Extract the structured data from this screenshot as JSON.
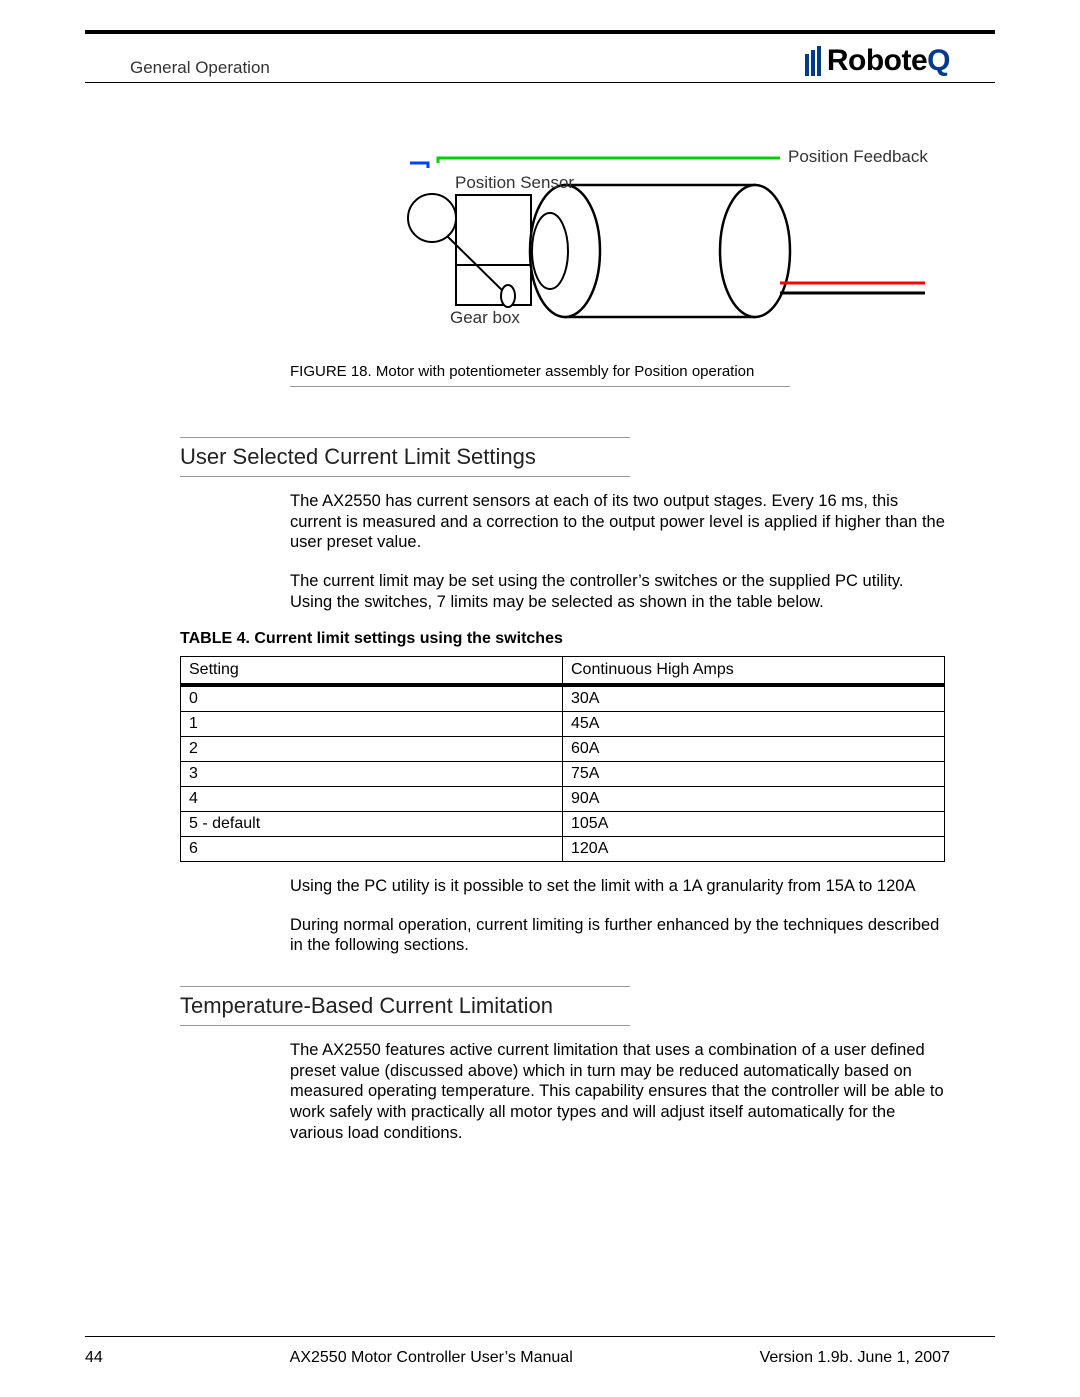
{
  "header": {
    "section": "General Operation",
    "brand": "Robote",
    "brand_suffix": "Q"
  },
  "figure": {
    "label_sensor": "Position Sensor",
    "label_feedback": "Position Feedback",
    "label_gearbox": "Gear box",
    "caption": "FIGURE 18.  Motor with potentiometer assembly for Position operation"
  },
  "section1": {
    "title": "User Selected Current Limit Settings",
    "p1": "The AX2550 has current sensors at each of its two output stages. Every 16 ms, this current is measured and a correction to the output power level is applied if higher than the user preset value.",
    "p2": "The current limit may be set using the controller’s switches or the supplied PC utility. Using the switches, 7 limits may be selected as shown in the table below.",
    "table_caption": "TABLE 4. Current limit settings using the switches",
    "col1": "Setting",
    "col2": "Continuous High Amps",
    "rows": [
      {
        "setting": "0",
        "amps": "30A"
      },
      {
        "setting": "1",
        "amps": "45A"
      },
      {
        "setting": "2",
        "amps": "60A"
      },
      {
        "setting": "3",
        "amps": "75A"
      },
      {
        "setting": "4",
        "amps": "90A"
      },
      {
        "setting": "5 - default",
        "amps": "105A"
      },
      {
        "setting": "6",
        "amps": "120A"
      }
    ],
    "p3": "Using the PC utility is it possible to set the limit with a 1A granularity from 15A to 120A",
    "p4": "During normal operation, current limiting is further enhanced by the techniques described in the following sections."
  },
  "section2": {
    "title": "Temperature-Based Current Limitation",
    "p1": "The AX2550 features active current limitation that uses a combination of a user defined preset value (discussed above) which in turn may be reduced automatically based on measured operating temperature. This capability ensures that the controller will be able to work safely with practically all motor types and will adjust itself automatically for the various load conditions."
  },
  "footer": {
    "page": "44",
    "title": "AX2550 Motor Controller User’s Manual",
    "version": "Version 1.9b. June 1, 2007"
  }
}
